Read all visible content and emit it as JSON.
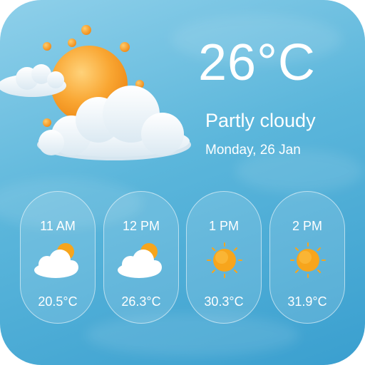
{
  "current": {
    "temperature": "26°C",
    "condition": "Partly cloudy",
    "date": "Monday, 26 Jan",
    "icon": "partly-cloudy-icon"
  },
  "hourly": [
    {
      "time": "11 AM",
      "temp": "20.5°C",
      "icon": "partly-cloudy-icon"
    },
    {
      "time": "12 PM",
      "temp": "26.3°C",
      "icon": "partly-cloudy-icon"
    },
    {
      "time": "1 PM",
      "temp": "30.3°C",
      "icon": "sun-icon"
    },
    {
      "time": "2 PM",
      "temp": "31.9°C",
      "icon": "sun-icon"
    }
  ],
  "colors": {
    "background": "#5bb6db",
    "sun": "#f7a51c",
    "text": "#ffffff"
  }
}
